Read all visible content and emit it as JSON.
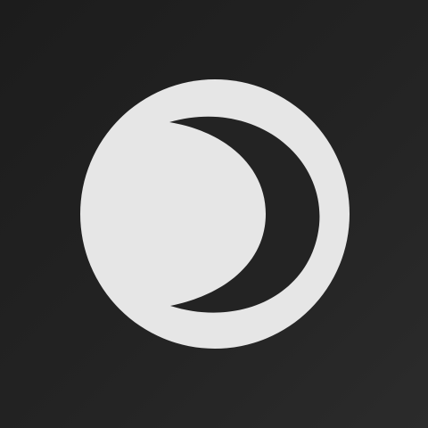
{
  "app_icon": {
    "icon": "moon-in-circle-icon",
    "colors": {
      "background": "#1e1e1e",
      "circle": "#e6e6e6",
      "crescent": "#232323"
    }
  }
}
